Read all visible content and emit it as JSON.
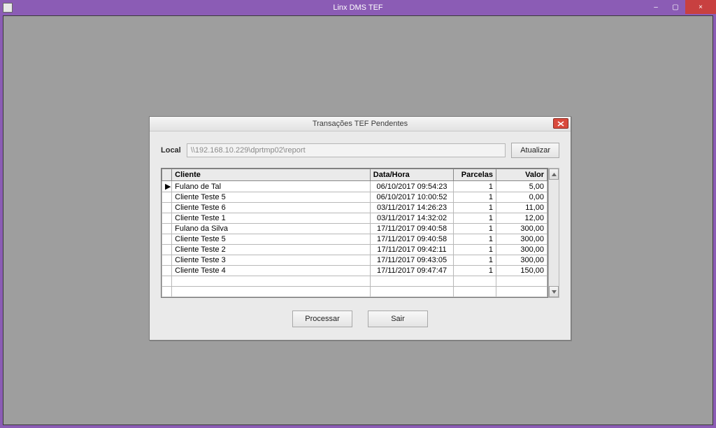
{
  "window": {
    "title": "Linx DMS TEF",
    "minimize": "–",
    "maximize": "▢",
    "close": "×"
  },
  "dialog": {
    "title": "Transações TEF Pendentes",
    "local_label": "Local",
    "local_value": "\\\\192.168.10.229\\dprtmp02\\report",
    "update_label": "Atualizar",
    "process_label": "Processar",
    "exit_label": "Sair",
    "columns": {
      "cliente": "Cliente",
      "datahora": "Data/Hora",
      "parcelas": "Parcelas",
      "valor": "Valor"
    },
    "rows": [
      {
        "selected": true,
        "cliente": "Fulano de Tal",
        "datahora": "06/10/2017 09:54:23",
        "parcelas": "1",
        "valor": "5,00"
      },
      {
        "selected": false,
        "cliente": "Cliente Teste 5",
        "datahora": "06/10/2017 10:00:52",
        "parcelas": "1",
        "valor": "0,00"
      },
      {
        "selected": false,
        "cliente": "Cliente Teste 6",
        "datahora": "03/11/2017 14:26:23",
        "parcelas": "1",
        "valor": "11,00"
      },
      {
        "selected": false,
        "cliente": "Cliente Teste 1",
        "datahora": "03/11/2017 14:32:02",
        "parcelas": "1",
        "valor": "12,00"
      },
      {
        "selected": false,
        "cliente": "Fulano da Silva",
        "datahora": "17/11/2017 09:40:58",
        "parcelas": "1",
        "valor": "300,00"
      },
      {
        "selected": false,
        "cliente": "Cliente Teste 5",
        "datahora": "17/11/2017 09:40:58",
        "parcelas": "1",
        "valor": "300,00"
      },
      {
        "selected": false,
        "cliente": "Cliente Teste 2",
        "datahora": "17/11/2017 09:42:11",
        "parcelas": "1",
        "valor": "300,00"
      },
      {
        "selected": false,
        "cliente": "Cliente Teste 3",
        "datahora": "17/11/2017 09:43:05",
        "parcelas": "1",
        "valor": "300,00"
      },
      {
        "selected": false,
        "cliente": "Cliente Teste 4",
        "datahora": "17/11/2017 09:47:47",
        "parcelas": "1",
        "valor": "150,00"
      }
    ]
  }
}
